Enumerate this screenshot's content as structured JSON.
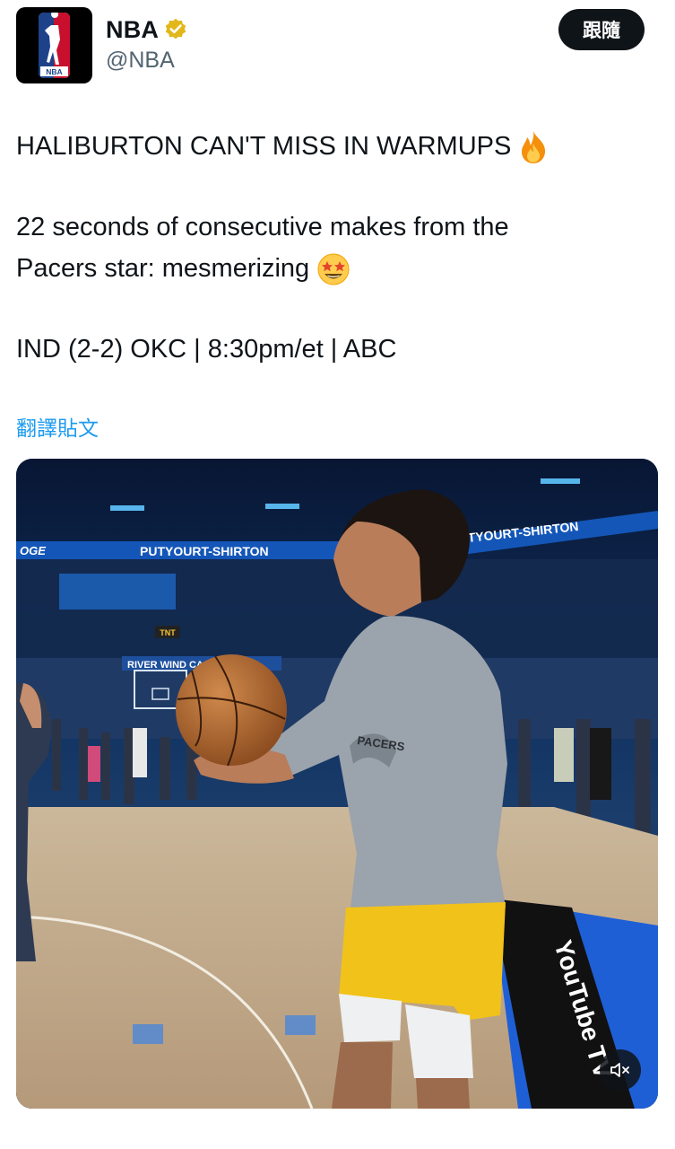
{
  "account": {
    "name": "NBA",
    "handle": "@NBA",
    "logo_text": "NBA",
    "verified_color": "#e2b719"
  },
  "follow_button": {
    "label": "跟隨"
  },
  "tweet": {
    "line1": "HALIBURTON CAN'T MISS IN WARMUPS",
    "line2": "22 seconds of consecutive makes from the",
    "line3": "Pacers star: mesmerizing",
    "line4": "IND (2-2) OKC | 8:30pm/et | ABC",
    "emoji1": "fire-emoji",
    "emoji2": "star-struck-emoji"
  },
  "translate_link": "翻譯貼文",
  "media": {
    "type": "video",
    "signs": {
      "ribbon_left": "PUTYOURT-SHIRTON",
      "ribbon_right": "PUTYOURT-SHIRTON",
      "ribbon_edge": "OGE",
      "casino_banner": "RIVER WIND CASINO",
      "tnt_badge": "TNT",
      "court_brand": "YouTube TV"
    },
    "shirt_text": "PACERS",
    "mute_icon": "muted-speaker-icon"
  },
  "colors": {
    "link": "#1d9bf0",
    "text": "#0f1419",
    "secondary": "#536471"
  }
}
